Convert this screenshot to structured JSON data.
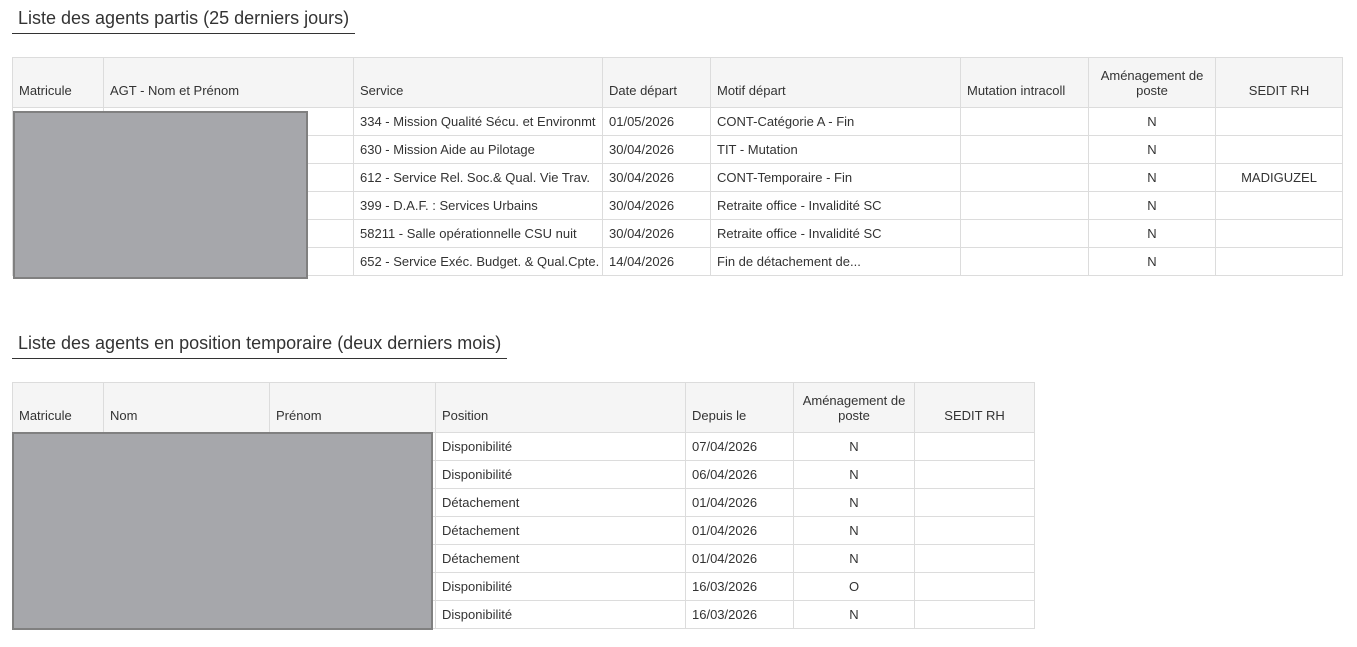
{
  "departed": {
    "title": "Liste des agents partis (25 derniers jours)",
    "headers": {
      "matricule": "Matricule",
      "agent": "AGT - Nom et Prénom",
      "service": "Service",
      "date": "Date départ",
      "motif": "Motif départ",
      "mutation": "Mutation intracoll",
      "amenagement": "Aménagement de poste",
      "sedit": "SEDIT RH"
    },
    "rows": [
      {
        "service": "334 - Mission Qualité Sécu. et Environmt",
        "date": "01/05/2026",
        "motif": "CONT-Catégorie A - Fin",
        "mutation": "",
        "amenagement": "N",
        "sedit": ""
      },
      {
        "service": "630 - Mission Aide au Pilotage",
        "date": "30/04/2026",
        "motif": "TIT - Mutation",
        "mutation": "",
        "amenagement": "N",
        "sedit": ""
      },
      {
        "service": "612 - Service Rel. Soc.& Qual. Vie Trav.",
        "date": "30/04/2026",
        "motif": "CONT-Temporaire - Fin",
        "mutation": "",
        "amenagement": "N",
        "sedit": "MADIGUZEL"
      },
      {
        "service": "399 - D.A.F. : Services Urbains",
        "date": "30/04/2026",
        "motif": "Retraite office - Invalidité SC",
        "mutation": "",
        "amenagement": "N",
        "sedit": ""
      },
      {
        "service": "58211 - Salle opérationnelle CSU nuit",
        "date": "30/04/2026",
        "motif": "Retraite office - Invalidité SC",
        "mutation": "",
        "amenagement": "N",
        "sedit": ""
      },
      {
        "service": "652 - Service Exéc. Budget. & Qual.Cpte.",
        "date": "14/04/2026",
        "motif": "Fin de détachement de...",
        "mutation": "",
        "amenagement": "N",
        "sedit": ""
      }
    ]
  },
  "temporary": {
    "title": "Liste des agents en position temporaire (deux derniers mois)",
    "headers": {
      "matricule": "Matricule",
      "nom": "Nom",
      "prenom": "Prénom",
      "position": "Position",
      "depuis": "Depuis le",
      "amenagement": "Aménagement de poste",
      "sedit": "SEDIT RH"
    },
    "rows": [
      {
        "position": "Disponibilité",
        "depuis": "07/04/2026",
        "amenagement": "N",
        "sedit": ""
      },
      {
        "position": "Disponibilité",
        "depuis": "06/04/2026",
        "amenagement": "N",
        "sedit": ""
      },
      {
        "position": "Détachement",
        "depuis": "01/04/2026",
        "amenagement": "N",
        "sedit": ""
      },
      {
        "position": "Détachement",
        "depuis": "01/04/2026",
        "amenagement": "N",
        "sedit": ""
      },
      {
        "position": "Détachement",
        "depuis": "01/04/2026",
        "amenagement": "N",
        "sedit": ""
      },
      {
        "position": "Disponibilité",
        "depuis": "16/03/2026",
        "amenagement": "O",
        "sedit": ""
      },
      {
        "position": "Disponibilité",
        "depuis": "16/03/2026",
        "amenagement": "N",
        "sedit": ""
      }
    ]
  },
  "redaction_color": "#a6a7ab"
}
